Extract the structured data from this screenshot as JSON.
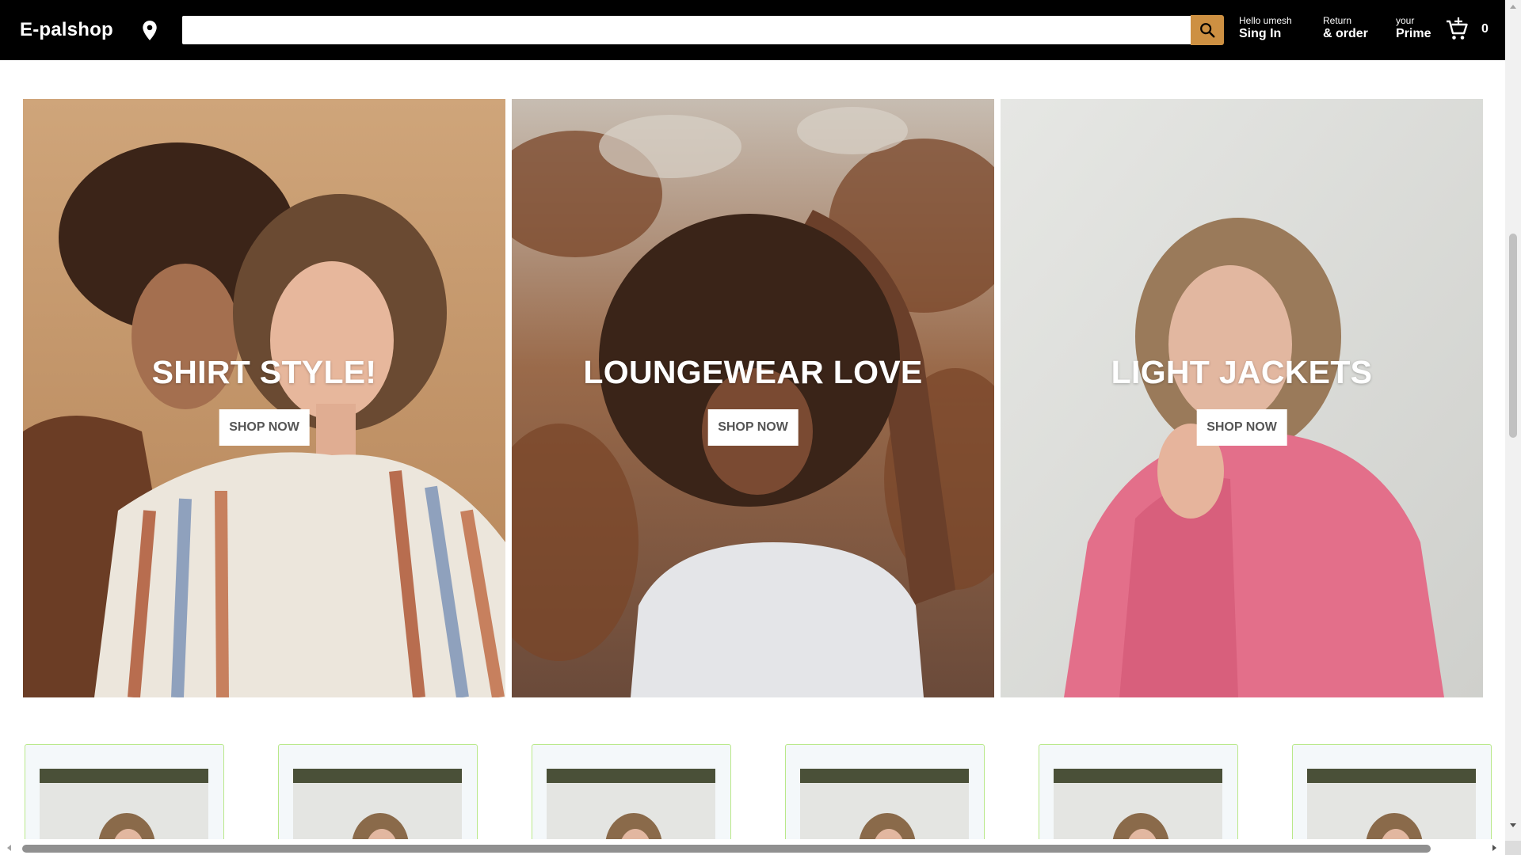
{
  "header": {
    "logo": "E-palshop",
    "location_icon": "map-pin-icon",
    "search": {
      "value": "",
      "placeholder": "",
      "button_icon": "search-icon",
      "button_color": "#cd9042"
    },
    "signin": {
      "line1": "Hello umesh",
      "line2": "Sing In"
    },
    "orders": {
      "line1": "Return",
      "line2": "& order"
    },
    "prime": {
      "line1": "your",
      "line2": "Prime"
    },
    "cart": {
      "icon": "cart-icon",
      "count": "0"
    },
    "background": "#000000"
  },
  "banners": [
    {
      "title": "SHIRT STYLE!",
      "button": "SHOP NOW"
    },
    {
      "title": "LOUNGEWEAR LOVE",
      "button": "SHOP NOW"
    },
    {
      "title": "LIGHT JACKETS",
      "button": "SHOP NOW"
    }
  ],
  "product_cards": {
    "count": 6,
    "border_color": "#b9e88a",
    "background": "#f4f8fa"
  }
}
